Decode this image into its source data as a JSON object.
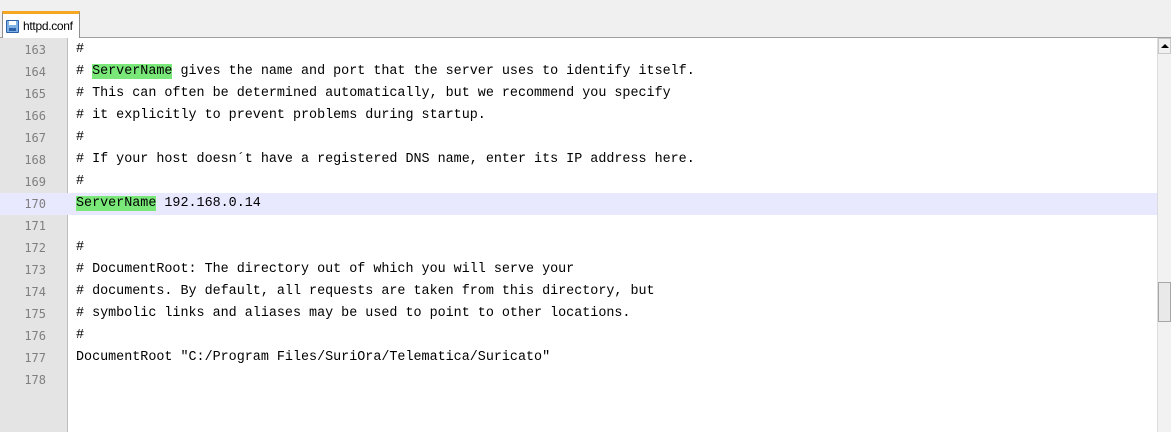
{
  "tab": {
    "label": "httpd.conf",
    "icon": "save-file-icon"
  },
  "colors": {
    "highlight": "#79e879",
    "current_line": "#e8e8ff",
    "tab_accent": "#f5a623"
  },
  "lines": [
    {
      "num": "163",
      "parts": [
        {
          "text": "#"
        }
      ]
    },
    {
      "num": "164",
      "parts": [
        {
          "text": "# "
        },
        {
          "text": "ServerName",
          "hl": true
        },
        {
          "text": " gives the name and port that the server uses to identify itself."
        }
      ]
    },
    {
      "num": "165",
      "parts": [
        {
          "text": "# This can often be determined automatically, but we recommend you specify"
        }
      ]
    },
    {
      "num": "166",
      "parts": [
        {
          "text": "# it explicitly to prevent problems during startup."
        }
      ]
    },
    {
      "num": "167",
      "parts": [
        {
          "text": "#"
        }
      ]
    },
    {
      "num": "168",
      "parts": [
        {
          "text": "# If your host doesn´t have a registered DNS name, enter its IP address here."
        }
      ]
    },
    {
      "num": "169",
      "parts": [
        {
          "text": "#"
        }
      ]
    },
    {
      "num": "170",
      "current": true,
      "parts": [
        {
          "text": "ServerName",
          "hl": true
        },
        {
          "text": " 192.168.0.14"
        }
      ]
    },
    {
      "num": "171",
      "parts": []
    },
    {
      "num": "172",
      "parts": [
        {
          "text": "#"
        }
      ]
    },
    {
      "num": "173",
      "parts": [
        {
          "text": "# DocumentRoot: The directory out of which you will serve your"
        }
      ]
    },
    {
      "num": "174",
      "parts": [
        {
          "text": "# documents. By default, all requests are taken from this directory, but"
        }
      ]
    },
    {
      "num": "175",
      "parts": [
        {
          "text": "# symbolic links and aliases may be used to point to other locations."
        }
      ]
    },
    {
      "num": "176",
      "parts": [
        {
          "text": "#"
        }
      ]
    },
    {
      "num": "177",
      "parts": [
        {
          "text": "DocumentRoot \"C:/Program Files/SuriOra/Telematica/Suricato\""
        }
      ]
    },
    {
      "num": "178",
      "parts": []
    }
  ]
}
